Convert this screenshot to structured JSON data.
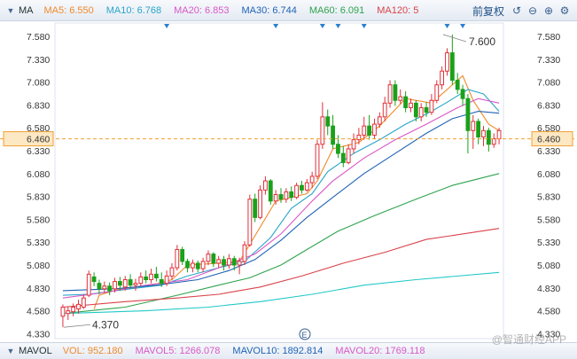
{
  "top_bar": {
    "indicator": "MA",
    "ma": [
      {
        "label": "MA5: 6.550",
        "color": "#f08a2a"
      },
      {
        "label": "MA10: 6.768",
        "color": "#2aa5c8"
      },
      {
        "label": "MA20: 6.853",
        "color": "#d957c7"
      },
      {
        "label": "MA30: 6.744",
        "color": "#1f63b5"
      },
      {
        "label": "MA60: 6.091",
        "color": "#2fa34e"
      },
      {
        "label": "MA120: 5",
        "color": "#d9424a"
      }
    ],
    "adjust_label": "前复权"
  },
  "bottom_bar": {
    "indicator": "MAVOL",
    "items": [
      {
        "label": "VOL: 952.180",
        "color": "#f08a2a"
      },
      {
        "label": "MAVOL5: 1266.078",
        "color": "#d957c7"
      },
      {
        "label": "MAVOL10: 1892.814",
        "color": "#1f63b5"
      },
      {
        "label": "MAVOL20: 1769.118",
        "color": "#d957c7"
      }
    ]
  },
  "watermark": "@智通财经APP",
  "colors": {
    "up": "#e0303a",
    "down": "#1aa11a",
    "price_line": "#f0a030",
    "axis": "#333333"
  },
  "chart_data": {
    "type": "candlestick",
    "y_ticks": [
      "7.580",
      "7.330",
      "7.080",
      "6.830",
      "6.580",
      "6.330",
      "6.080",
      "5.830",
      "5.580",
      "5.330",
      "5.080",
      "4.830",
      "4.580",
      "4.330"
    ],
    "ylim": [
      4.33,
      7.58
    ],
    "current_price": "6.460",
    "high_label": "7.600",
    "low_label": "4.370",
    "candles": [
      [
        4.52,
        4.62,
        4.4,
        4.65
      ],
      [
        4.55,
        4.58,
        4.48,
        4.63
      ],
      [
        4.57,
        4.62,
        4.52,
        4.66
      ],
      [
        4.6,
        4.65,
        4.55,
        4.7
      ],
      [
        4.62,
        4.72,
        4.6,
        4.76
      ],
      [
        4.75,
        4.98,
        4.73,
        5.02
      ],
      [
        4.95,
        4.9,
        4.85,
        5.0
      ],
      [
        4.88,
        4.82,
        4.76,
        4.92
      ],
      [
        4.82,
        4.85,
        4.78,
        4.9
      ],
      [
        4.85,
        4.8,
        4.75,
        4.89
      ],
      [
        4.82,
        4.9,
        4.78,
        4.94
      ],
      [
        4.9,
        4.86,
        4.8,
        4.95
      ],
      [
        4.84,
        4.92,
        4.8,
        4.96
      ],
      [
        4.92,
        4.86,
        4.82,
        4.98
      ],
      [
        4.86,
        4.88,
        4.8,
        4.93
      ],
      [
        4.88,
        4.95,
        4.85,
        5.0
      ],
      [
        4.95,
        4.92,
        4.88,
        5.02
      ],
      [
        4.92,
        4.98,
        4.88,
        5.04
      ],
      [
        4.98,
        4.94,
        4.9,
        5.06
      ],
      [
        4.92,
        4.88,
        4.84,
        5.0
      ],
      [
        4.88,
        4.96,
        4.85,
        5.02
      ],
      [
        4.96,
        5.05,
        4.92,
        5.1
      ],
      [
        5.05,
        5.25,
        5.02,
        5.3
      ],
      [
        5.25,
        5.12,
        5.08,
        5.28
      ],
      [
        5.12,
        5.05,
        5.0,
        5.15
      ],
      [
        5.05,
        5.1,
        5.0,
        5.14
      ],
      [
        5.1,
        5.04,
        5.0,
        5.13
      ],
      [
        5.04,
        5.12,
        5.0,
        5.16
      ],
      [
        5.12,
        5.2,
        5.08,
        5.24
      ],
      [
        5.2,
        5.1,
        5.06,
        5.22
      ],
      [
        5.1,
        5.14,
        5.05,
        5.18
      ],
      [
        5.14,
        5.08,
        5.02,
        5.18
      ],
      [
        5.08,
        5.15,
        5.04,
        5.2
      ],
      [
        5.15,
        5.08,
        5.02,
        5.18
      ],
      [
        5.08,
        5.12,
        4.98,
        5.16
      ],
      [
        5.12,
        5.3,
        5.08,
        5.34
      ],
      [
        5.3,
        5.8,
        5.28,
        5.85
      ],
      [
        5.8,
        5.6,
        5.55,
        5.86
      ],
      [
        5.6,
        5.9,
        5.58,
        5.95
      ],
      [
        5.9,
        6.0,
        5.85,
        6.05
      ],
      [
        6.0,
        5.78,
        5.74,
        6.02
      ],
      [
        5.78,
        5.85,
        5.74,
        5.9
      ],
      [
        5.85,
        5.8,
        5.76,
        5.92
      ],
      [
        5.8,
        5.88,
        5.76,
        5.92
      ],
      [
        5.88,
        5.82,
        5.78,
        5.94
      ],
      [
        5.82,
        5.95,
        5.8,
        5.98
      ],
      [
        5.95,
        5.9,
        5.86,
        6.0
      ],
      [
        5.9,
        5.98,
        5.88,
        6.02
      ],
      [
        5.98,
        6.05,
        5.92,
        6.1
      ],
      [
        6.05,
        6.4,
        6.02,
        6.45
      ],
      [
        6.4,
        6.7,
        6.35,
        6.86
      ],
      [
        6.7,
        6.6,
        6.5,
        6.78
      ],
      [
        6.6,
        6.4,
        6.35,
        6.72
      ],
      [
        6.4,
        6.3,
        6.25,
        6.5
      ],
      [
        6.3,
        6.2,
        6.15,
        6.38
      ],
      [
        6.2,
        6.35,
        6.18,
        6.4
      ],
      [
        6.35,
        6.45,
        6.3,
        6.52
      ],
      [
        6.45,
        6.5,
        6.4,
        6.58
      ],
      [
        6.5,
        6.6,
        6.45,
        6.7
      ],
      [
        6.6,
        6.5,
        6.45,
        6.72
      ],
      [
        6.5,
        6.62,
        6.46,
        6.68
      ],
      [
        6.62,
        6.7,
        6.58,
        6.75
      ],
      [
        6.7,
        6.85,
        6.65,
        6.92
      ],
      [
        6.85,
        7.05,
        6.8,
        7.1
      ],
      [
        7.05,
        6.88,
        6.82,
        7.1
      ],
      [
        6.88,
        6.92,
        6.84,
        7.0
      ],
      [
        6.92,
        6.8,
        6.75,
        6.98
      ],
      [
        6.8,
        6.85,
        6.75,
        6.9
      ],
      [
        6.85,
        6.7,
        6.65,
        6.88
      ],
      [
        6.7,
        6.8,
        6.65,
        6.85
      ],
      [
        6.8,
        6.75,
        6.7,
        6.86
      ],
      [
        6.75,
        6.88,
        6.72,
        6.95
      ],
      [
        6.88,
        7.05,
        6.85,
        7.1
      ],
      [
        7.05,
        7.2,
        7.0,
        7.25
      ],
      [
        7.2,
        7.4,
        7.15,
        7.45
      ],
      [
        7.4,
        7.1,
        7.05,
        7.6
      ],
      [
        7.1,
        7.0,
        6.95,
        7.18
      ],
      [
        7.0,
        6.9,
        6.82,
        7.05
      ],
      [
        6.9,
        6.55,
        6.3,
        6.95
      ],
      [
        6.55,
        6.65,
        6.35,
        6.72
      ],
      [
        6.65,
        6.48,
        6.4,
        6.68
      ],
      [
        6.48,
        6.55,
        6.38,
        6.6
      ],
      [
        6.55,
        6.4,
        6.32,
        6.58
      ],
      [
        6.4,
        6.46,
        6.36,
        6.52
      ],
      [
        6.46,
        6.55,
        6.4,
        6.58
      ]
    ],
    "ma_lines": {
      "ma5": [
        [
          4.6,
          6
        ],
        [
          4.75,
          7
        ],
        [
          4.82,
          11
        ],
        [
          4.86,
          17
        ],
        [
          4.92,
          21
        ],
        [
          5.08,
          24
        ],
        [
          5.1,
          30
        ],
        [
          5.12,
          34
        ],
        [
          5.4,
          37
        ],
        [
          5.78,
          41
        ],
        [
          5.86,
          47
        ],
        [
          6.0,
          49
        ],
        [
          6.35,
          52
        ],
        [
          6.42,
          57
        ],
        [
          6.6,
          61
        ],
        [
          6.9,
          66
        ],
        [
          6.85,
          71
        ],
        [
          7.0,
          74
        ],
        [
          7.15,
          77
        ],
        [
          6.88,
          79
        ],
        [
          6.62,
          82
        ],
        [
          6.55,
          84
        ]
      ],
      "ma10": [
        [
          4.75,
          0
        ],
        [
          4.76,
          5
        ],
        [
          4.82,
          13
        ],
        [
          4.86,
          19
        ],
        [
          4.96,
          24
        ],
        [
          5.05,
          30
        ],
        [
          5.12,
          35
        ],
        [
          5.38,
          40
        ],
        [
          5.7,
          44
        ],
        [
          5.86,
          48
        ],
        [
          6.1,
          51
        ],
        [
          6.3,
          56
        ],
        [
          6.45,
          61
        ],
        [
          6.62,
          66
        ],
        [
          6.76,
          71
        ],
        [
          6.86,
          74
        ],
        [
          7.0,
          78
        ],
        [
          6.95,
          81
        ],
        [
          6.76,
          84
        ]
      ],
      "ma20": [
        [
          4.72,
          0
        ],
        [
          4.78,
          8
        ],
        [
          4.86,
          16
        ],
        [
          4.92,
          24
        ],
        [
          5.05,
          30
        ],
        [
          5.2,
          37
        ],
        [
          5.42,
          42
        ],
        [
          5.78,
          48
        ],
        [
          6.0,
          52
        ],
        [
          6.25,
          58
        ],
        [
          6.45,
          64
        ],
        [
          6.62,
          70
        ],
        [
          6.8,
          76
        ],
        [
          6.9,
          80
        ],
        [
          6.85,
          84
        ]
      ],
      "ma30": [
        [
          4.8,
          0
        ],
        [
          4.82,
          10
        ],
        [
          4.86,
          18
        ],
        [
          4.92,
          26
        ],
        [
          5.02,
          32
        ],
        [
          5.14,
          37
        ],
        [
          5.35,
          42
        ],
        [
          5.6,
          47
        ],
        [
          5.82,
          52
        ],
        [
          6.08,
          58
        ],
        [
          6.3,
          64
        ],
        [
          6.52,
          70
        ],
        [
          6.68,
          75
        ],
        [
          6.76,
          80
        ],
        [
          6.74,
          84
        ]
      ],
      "ma60": [
        [
          4.55,
          0
        ],
        [
          4.62,
          12
        ],
        [
          4.75,
          22
        ],
        [
          4.86,
          30
        ],
        [
          4.94,
          36
        ],
        [
          5.08,
          42
        ],
        [
          5.25,
          47
        ],
        [
          5.45,
          53
        ],
        [
          5.62,
          60
        ],
        [
          5.8,
          68
        ],
        [
          5.95,
          75
        ],
        [
          6.08,
          84
        ]
      ],
      "ma120": [
        [
          4.62,
          0
        ],
        [
          4.68,
          12
        ],
        [
          4.72,
          22
        ],
        [
          4.76,
          30
        ],
        [
          4.84,
          38
        ],
        [
          4.96,
          46
        ],
        [
          5.1,
          54
        ],
        [
          5.22,
          62
        ],
        [
          5.36,
          70
        ],
        [
          5.48,
          84
        ]
      ],
      "ma250": [
        [
          4.55,
          0
        ],
        [
          4.58,
          16
        ],
        [
          4.62,
          28
        ],
        [
          4.68,
          38
        ],
        [
          4.76,
          48
        ],
        [
          4.86,
          58
        ],
        [
          4.92,
          68
        ],
        [
          5.0,
          84
        ]
      ]
    },
    "markers_top": [
      20,
      41,
      50,
      53,
      58,
      74,
      77
    ],
    "marker_bottom": "E"
  }
}
